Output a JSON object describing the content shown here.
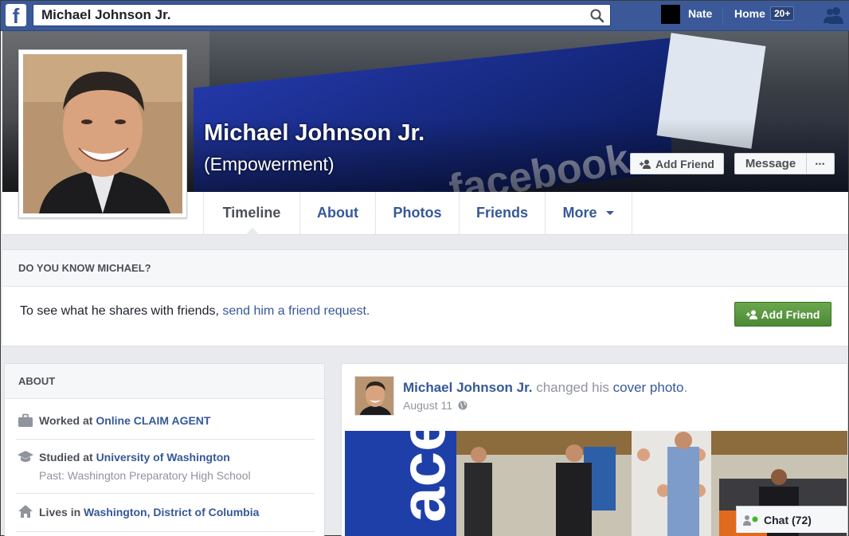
{
  "topbar": {
    "logo": "f",
    "search_value": "Michael Johnson Jr.",
    "user_name": "Nate",
    "home_label": "Home",
    "home_badge": "20+"
  },
  "profile": {
    "name": "Michael Johnson Jr.",
    "alternate_name": "(Empowerment)",
    "add_friend_label": "Add Friend",
    "message_label": "Message",
    "more_dots": "•••"
  },
  "cover_text": "facebook",
  "tabs": [
    {
      "label": "Timeline"
    },
    {
      "label": "About"
    },
    {
      "label": "Photos"
    },
    {
      "label": "Friends"
    },
    {
      "label": "More"
    }
  ],
  "know": {
    "heading": "DO YOU KNOW MICHAEL?",
    "text": "To see what he shares with friends, ",
    "link": "send him a friend request.",
    "button_label": "Add Friend"
  },
  "about": {
    "heading": "ABOUT",
    "work_prefix": "Worked at ",
    "work_link": "Online CLAIM AGENT",
    "school_prefix": "Studied at ",
    "school_link": "University of Washington",
    "school_past": "Past: Washington Preparatory High School",
    "lives_prefix": "Lives in ",
    "lives_link": "Washington, District of Columbia"
  },
  "post": {
    "author": "Michael Johnson Jr.",
    "action_text": " changed his ",
    "action_link": "cover photo",
    "action_end": ".",
    "date": "August 11",
    "image_text": "acel"
  },
  "chat": {
    "label": "Chat (72)"
  },
  "colors": {
    "brand_blue": "#3b5998",
    "link_blue": "#365899",
    "green_button": "#4d8a36",
    "online_dot": "#42b72a"
  }
}
